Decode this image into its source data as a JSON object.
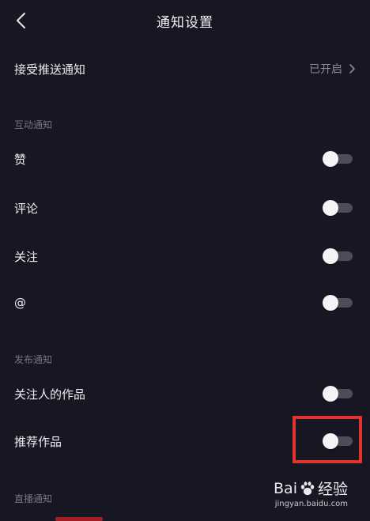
{
  "header": {
    "title": "通知设置",
    "back_icon": "chevron-left-icon"
  },
  "push": {
    "label": "接受推送通知",
    "value": "已开启",
    "chevron_icon": "chevron-right-icon"
  },
  "sections": [
    {
      "title": "互动通知",
      "items": [
        {
          "label": "赞",
          "enabled": false
        },
        {
          "label": "评论",
          "enabled": false
        },
        {
          "label": "关注",
          "enabled": false
        },
        {
          "label": "@",
          "enabled": false
        }
      ]
    },
    {
      "title": "发布通知",
      "items": [
        {
          "label": "关注人的作品",
          "enabled": false
        },
        {
          "label": "推荐作品",
          "enabled": false
        }
      ]
    },
    {
      "title": "直播通知",
      "items": []
    }
  ],
  "watermark": {
    "brand_left": "Bai",
    "brand_right": "经验",
    "url": "jingyan.baidu.com",
    "paw_icon": "paw-icon"
  },
  "colors": {
    "background": "#161722",
    "highlight": "#e0342f",
    "toggle_track": "#4c4d56",
    "toggle_knob": "#f4f4f6"
  }
}
